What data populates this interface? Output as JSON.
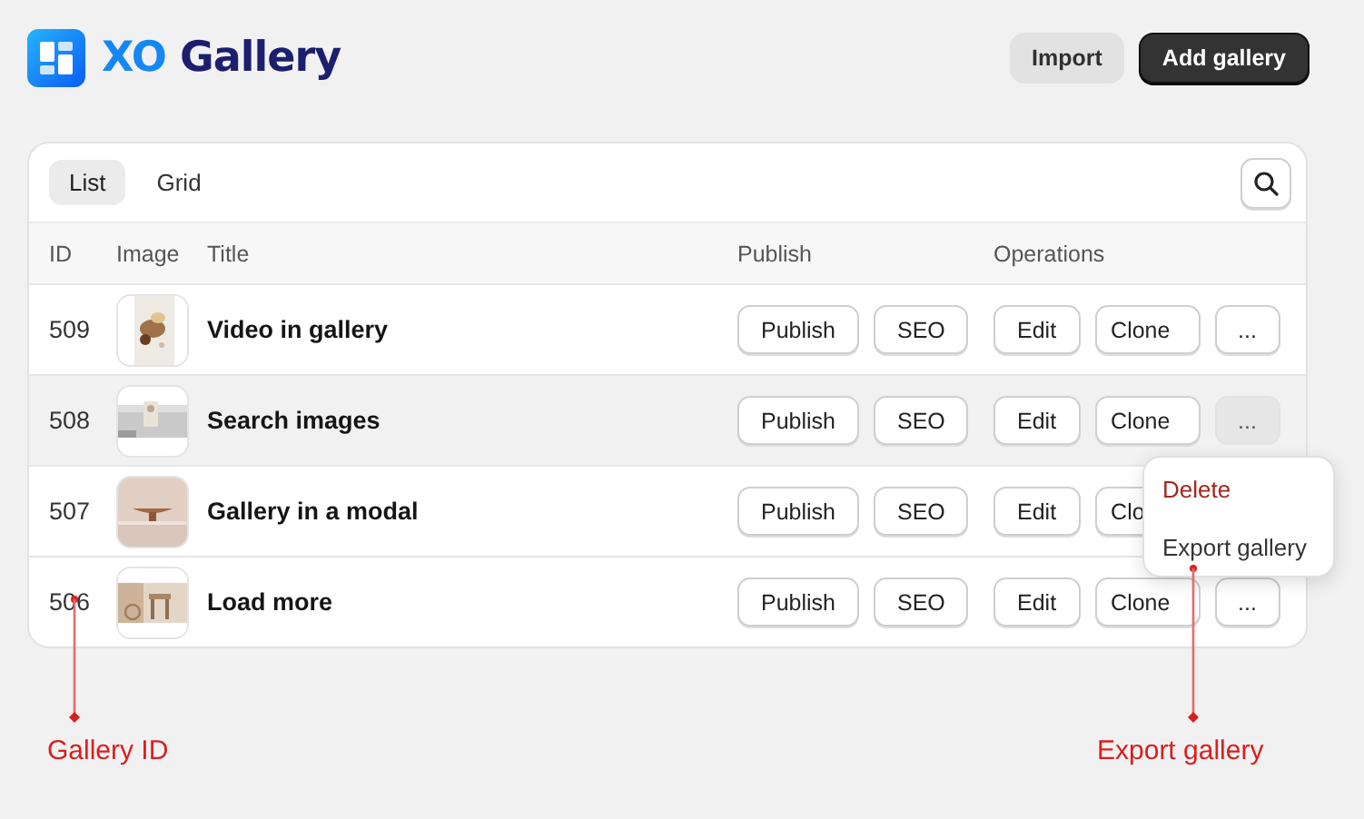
{
  "header": {
    "logo_prefix": "XO",
    "logo_name": "Gallery",
    "buttons": [
      {
        "label": "Import",
        "kind": "secondary"
      },
      {
        "label": "Add gallery",
        "kind": "primary"
      }
    ]
  },
  "view_tabs": [
    {
      "label": "List",
      "selected": true
    },
    {
      "label": "Grid",
      "selected": false
    }
  ],
  "table": {
    "columns": [
      "ID",
      "Image",
      "Title",
      "Publish",
      "Operations"
    ],
    "rows": [
      {
        "id": "509",
        "image": {
          "kind": "picture"
        },
        "title": "Video in gallery",
        "publish_actions": [
          "Publish",
          "SEO"
        ],
        "operations": [
          "Edit",
          "Clone",
          "..."
        ],
        "highlighted": false,
        "menu_open": false
      },
      {
        "id": "508",
        "image": {
          "kind": "picture"
        },
        "title": "Search images",
        "publish_actions": [
          "Publish",
          "SEO"
        ],
        "operations": [
          "Edit",
          "Clone",
          "..."
        ],
        "highlighted": true,
        "menu_open": true
      },
      {
        "id": "507",
        "image": {
          "kind": "picture"
        },
        "title": "Gallery in a modal",
        "publish_actions": [
          "Publish",
          "SEO"
        ],
        "operations": [
          "Edit",
          "Clo"
        ],
        "highlighted": false
      },
      {
        "id": "506",
        "image": {
          "kind": "picture"
        },
        "title": "Load more",
        "publish_actions": [
          "Publish",
          "SEO"
        ],
        "operations": [
          "Edit",
          "Clone",
          "..."
        ],
        "highlighted": false,
        "menu_open": false
      }
    ]
  },
  "context_menu": {
    "items": [
      {
        "label": "Delete",
        "kind": "danger"
      },
      {
        "label": "Export gallery",
        "kind": "normal"
      }
    ]
  },
  "annotations": [
    {
      "label": "Gallery ID"
    },
    {
      "label": "Export gallery"
    }
  ]
}
